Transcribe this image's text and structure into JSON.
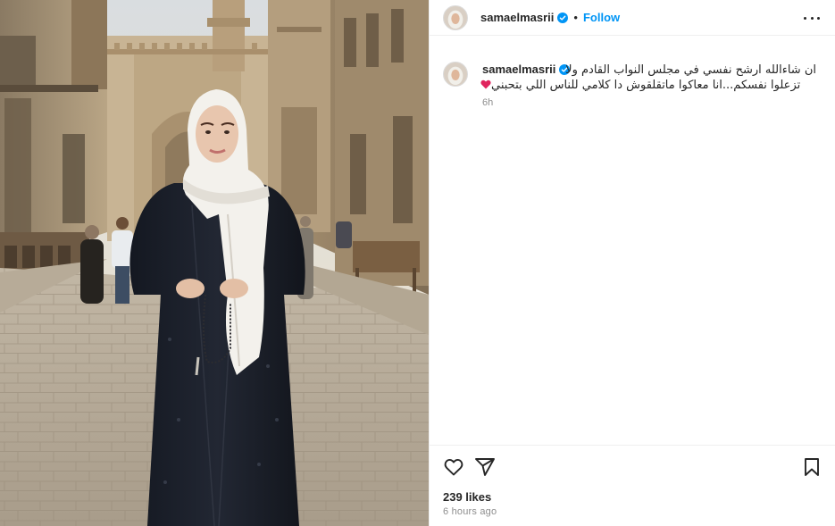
{
  "post": {
    "image_alt": "",
    "author": {
      "username": "samaelmasrii",
      "verified": true
    },
    "header": {
      "dot": "•",
      "follow_label": "Follow"
    },
    "caption": {
      "username": "samaelmasrii",
      "line1": "ان شاءالله ارشح نفسي في مجلس النواب القادم ولا",
      "line2": "تزعلوا نفسكم...انا معاكوا ماتقلقوش دا كلامي للناس اللي بتحبني",
      "emoji": "red-heart",
      "time": "6h"
    },
    "stats": {
      "likes": "239 likes",
      "time_ago": "6 hours ago"
    }
  },
  "icons": {
    "more": "more-options-icon",
    "like": "heart-icon",
    "share": "paper-plane-icon",
    "save": "bookmark-icon",
    "verified": "verified-badge-icon"
  },
  "colors": {
    "link_blue": "#0095f6",
    "verified_blue": "#0095f6",
    "text_dark": "#262626",
    "text_muted": "#8e8e8e",
    "border": "#efefef",
    "heart_red": "#e0245e"
  }
}
